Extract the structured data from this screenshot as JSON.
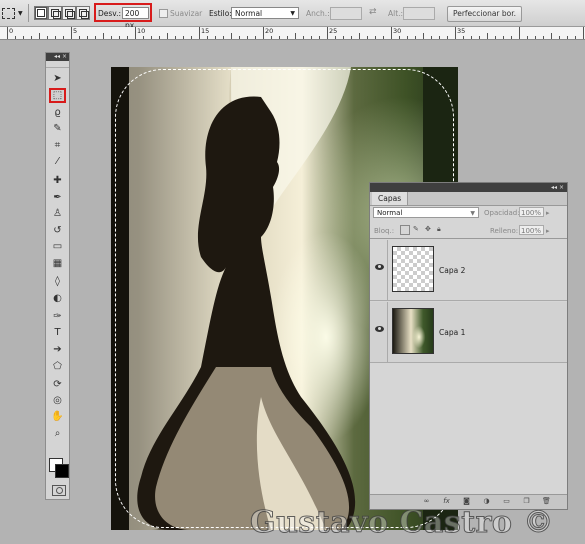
{
  "options_bar": {
    "feather_label": "Desv.:",
    "feather_value": "200 px",
    "antialias_label": "Suavizar",
    "style_label": "Estilo:",
    "style_value": "Normal",
    "width_label": "Anch.:",
    "height_label": "Alt.:",
    "refine_edge_label": "Perfeccionar bor."
  },
  "ruler": {
    "labels": [
      "0",
      "5",
      "10",
      "15",
      "20",
      "25",
      "30",
      "35"
    ]
  },
  "toolbox": {
    "collapse_glyph": "◂◂ ×",
    "tools": [
      {
        "name": "move-tool-icon",
        "glyph": "➤"
      },
      {
        "name": "rect-marquee-tool-icon",
        "glyph": "⬚",
        "active": true
      },
      {
        "name": "lasso-tool-icon",
        "glyph": "ϱ"
      },
      {
        "name": "quick-selection-tool-icon",
        "glyph": "✎"
      },
      {
        "name": "crop-tool-icon",
        "glyph": "⌗"
      },
      {
        "name": "eyedropper-tool-icon",
        "glyph": "⁄"
      },
      {
        "name": "healing-brush-tool-icon",
        "glyph": "✚"
      },
      {
        "name": "brush-tool-icon",
        "glyph": "✒"
      },
      {
        "name": "clone-stamp-tool-icon",
        "glyph": "♙"
      },
      {
        "name": "history-brush-tool-icon",
        "glyph": "↺"
      },
      {
        "name": "eraser-tool-icon",
        "glyph": "▭"
      },
      {
        "name": "gradient-tool-icon",
        "glyph": "▦"
      },
      {
        "name": "blur-tool-icon",
        "glyph": "◊"
      },
      {
        "name": "dodge-tool-icon",
        "glyph": "◐"
      },
      {
        "name": "pen-tool-icon",
        "glyph": "✑"
      },
      {
        "name": "type-tool-icon",
        "glyph": "T"
      },
      {
        "name": "path-selection-tool-icon",
        "glyph": "➔"
      },
      {
        "name": "shape-tool-icon",
        "glyph": "⬠"
      },
      {
        "name": "3d-rotate-tool-icon",
        "glyph": "⟳"
      },
      {
        "name": "3d-orbit-tool-icon",
        "glyph": "◎"
      },
      {
        "name": "hand-tool-icon",
        "glyph": "✋"
      },
      {
        "name": "zoom-tool-icon",
        "glyph": "⌕"
      }
    ]
  },
  "layers_panel": {
    "panel_header_glyph": "◂◂ ×",
    "tab_label": "Capas",
    "blend_mode": "Normal",
    "opacity_label": "Opacidad:",
    "opacity_value": "100%",
    "lock_label": "Bloq.:",
    "fill_label": "Relleno:",
    "fill_value": "100%",
    "layers": [
      {
        "name": "Capa 2",
        "visible": true,
        "thumbnail": "transparent"
      },
      {
        "name": "Capa 1",
        "visible": true,
        "thumbnail": "photo"
      }
    ],
    "footer_icons": [
      "link-layers-icon",
      "fx-icon",
      "layer-mask-icon",
      "adjustment-layer-icon",
      "group-folder-icon",
      "new-layer-icon",
      "delete-layer-icon"
    ]
  },
  "watermark": "Gustavo Castro ©",
  "colors": {
    "highlight_red": "#d81b1b",
    "ui_gray": "#b3b3b3",
    "panel_gray": "#d6d6d6",
    "foreground_swatch": "#ffffff",
    "background_swatch": "#000000"
  }
}
